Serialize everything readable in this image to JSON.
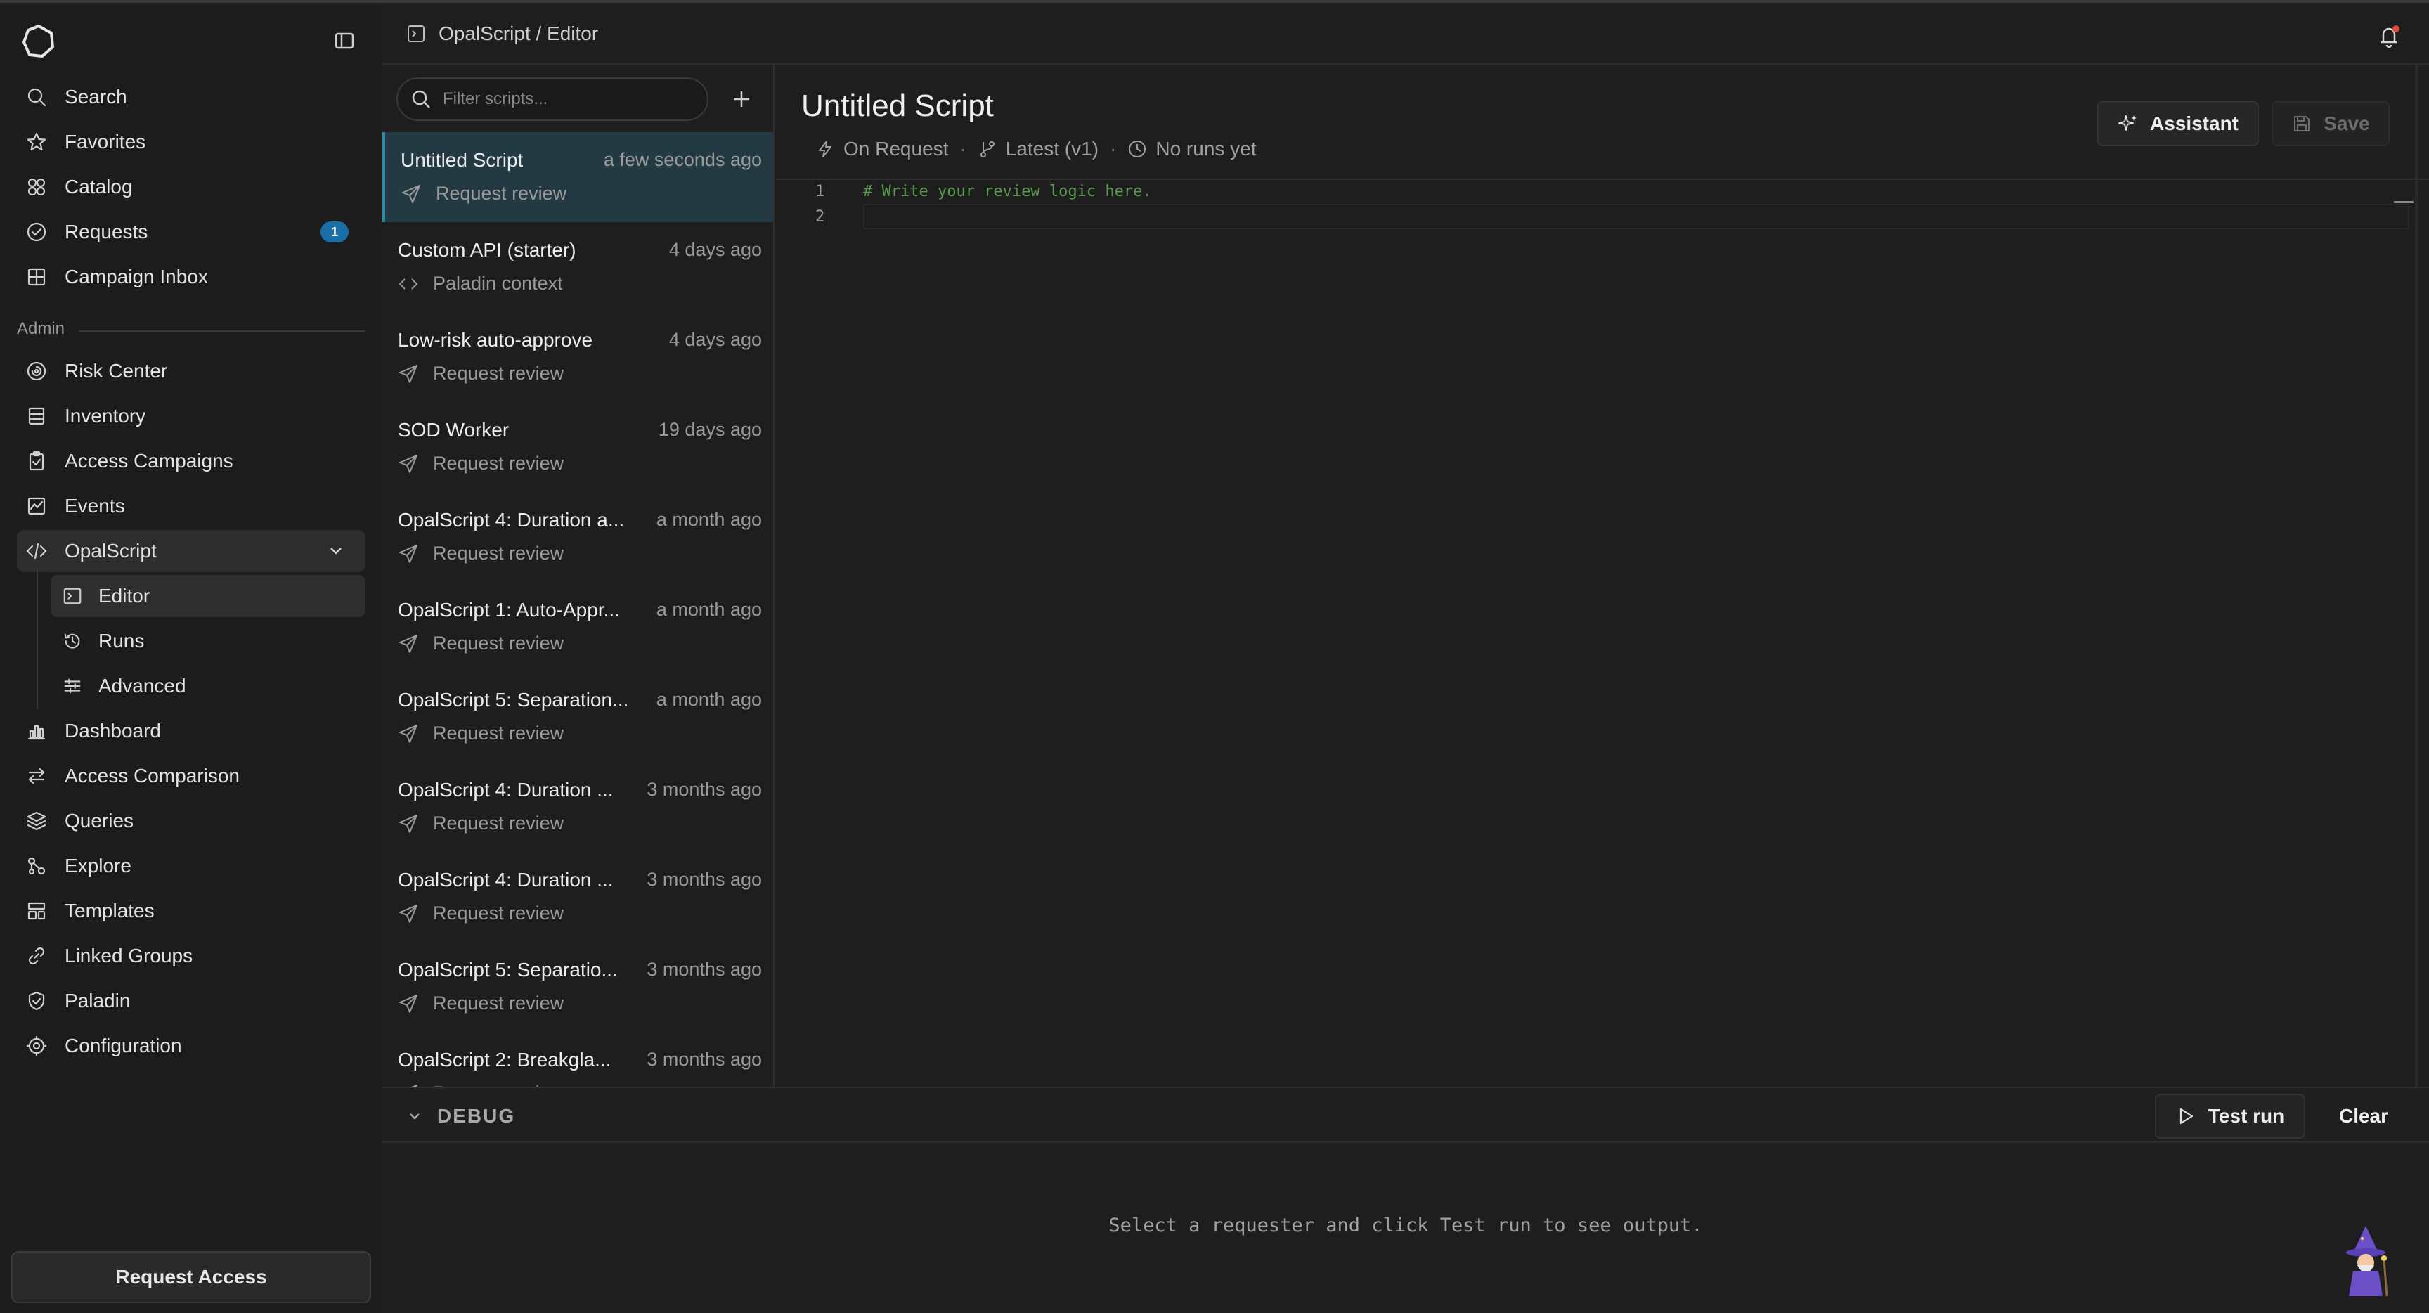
{
  "header": {
    "breadcrumb": "OpalScript / Editor"
  },
  "sidebar": {
    "main_items": [
      {
        "label": "Search",
        "icon": "search-icon"
      },
      {
        "label": "Favorites",
        "icon": "star-icon"
      },
      {
        "label": "Catalog",
        "icon": "catalog-icon"
      },
      {
        "label": "Requests",
        "icon": "check-circle-icon",
        "badge": "1"
      },
      {
        "label": "Campaign Inbox",
        "icon": "inbox-icon"
      }
    ],
    "section_label": "Admin",
    "admin_items": [
      {
        "label": "Risk Center",
        "icon": "risk-icon"
      },
      {
        "label": "Inventory",
        "icon": "inventory-icon"
      },
      {
        "label": "Access Campaigns",
        "icon": "clipboard-icon"
      },
      {
        "label": "Events",
        "icon": "activity-icon"
      },
      {
        "label": "OpalScript",
        "icon": "code-icon",
        "expanded": true
      }
    ],
    "sub_items": [
      {
        "label": "Editor",
        "icon": "terminal-icon",
        "active": true
      },
      {
        "label": "Runs",
        "icon": "history-icon"
      },
      {
        "label": "Advanced",
        "icon": "sliders-icon"
      }
    ],
    "more_items": [
      {
        "label": "Dashboard",
        "icon": "bar-chart-icon"
      },
      {
        "label": "Access Comparison",
        "icon": "compare-icon"
      },
      {
        "label": "Queries",
        "icon": "layers-icon"
      },
      {
        "label": "Explore",
        "icon": "explore-icon"
      },
      {
        "label": "Templates",
        "icon": "template-icon"
      },
      {
        "label": "Linked Groups",
        "icon": "link-icon"
      },
      {
        "label": "Paladin",
        "icon": "shield-icon"
      },
      {
        "label": "Configuration",
        "icon": "gear-icon"
      }
    ],
    "request_access": "Request Access"
  },
  "scripts": {
    "filter_placeholder": "Filter scripts...",
    "items": [
      {
        "name": "Untitled Script",
        "time": "a few seconds ago",
        "trigger": "Request review",
        "trigger_icon": "send-icon",
        "active": true
      },
      {
        "name": "Custom API (starter)",
        "time": "4 days ago",
        "trigger": "Paladin context",
        "trigger_icon": "code-brackets-icon"
      },
      {
        "name": "Low-risk auto-approve",
        "time": "4 days ago",
        "trigger": "Request review",
        "trigger_icon": "send-icon"
      },
      {
        "name": "SOD Worker",
        "time": "19 days ago",
        "trigger": "Request review",
        "trigger_icon": "send-icon"
      },
      {
        "name": "OpalScript 4: Duration a...",
        "time": "a month ago",
        "trigger": "Request review",
        "trigger_icon": "send-icon"
      },
      {
        "name": "OpalScript 1: Auto-Appr...",
        "time": "a month ago",
        "trigger": "Request review",
        "trigger_icon": "send-icon"
      },
      {
        "name": "OpalScript 5: Separation...",
        "time": "a month ago",
        "trigger": "Request review",
        "trigger_icon": "send-icon"
      },
      {
        "name": "OpalScript 4: Duration ...",
        "time": "3 months ago",
        "trigger": "Request review",
        "trigger_icon": "send-icon"
      },
      {
        "name": "OpalScript 4: Duration ...",
        "time": "3 months ago",
        "trigger": "Request review",
        "trigger_icon": "send-icon"
      },
      {
        "name": "OpalScript 5: Separatio...",
        "time": "3 months ago",
        "trigger": "Request review",
        "trigger_icon": "send-icon"
      },
      {
        "name": "OpalScript 2: Breakgla...",
        "time": "3 months ago",
        "trigger": "Request review",
        "trigger_icon": "send-icon"
      }
    ]
  },
  "editor": {
    "title": "Untitled Script",
    "meta": {
      "trigger": "On Request",
      "version": "Latest (v1)",
      "runs": "No runs yet"
    },
    "assistant_label": "Assistant",
    "save_label": "Save",
    "lines": [
      {
        "num": "1",
        "code": "# Write your review logic here."
      },
      {
        "num": "2",
        "code": ""
      }
    ]
  },
  "debug": {
    "label": "DEBUG",
    "test_run_label": "Test run",
    "clear_label": "Clear",
    "message": "Select a requester and click Test run to see output."
  },
  "colors": {
    "accent": "#2a8aa8",
    "badge": "#1b6fa8",
    "active_row": "#243a42",
    "code_comment": "#5a9a4e"
  }
}
